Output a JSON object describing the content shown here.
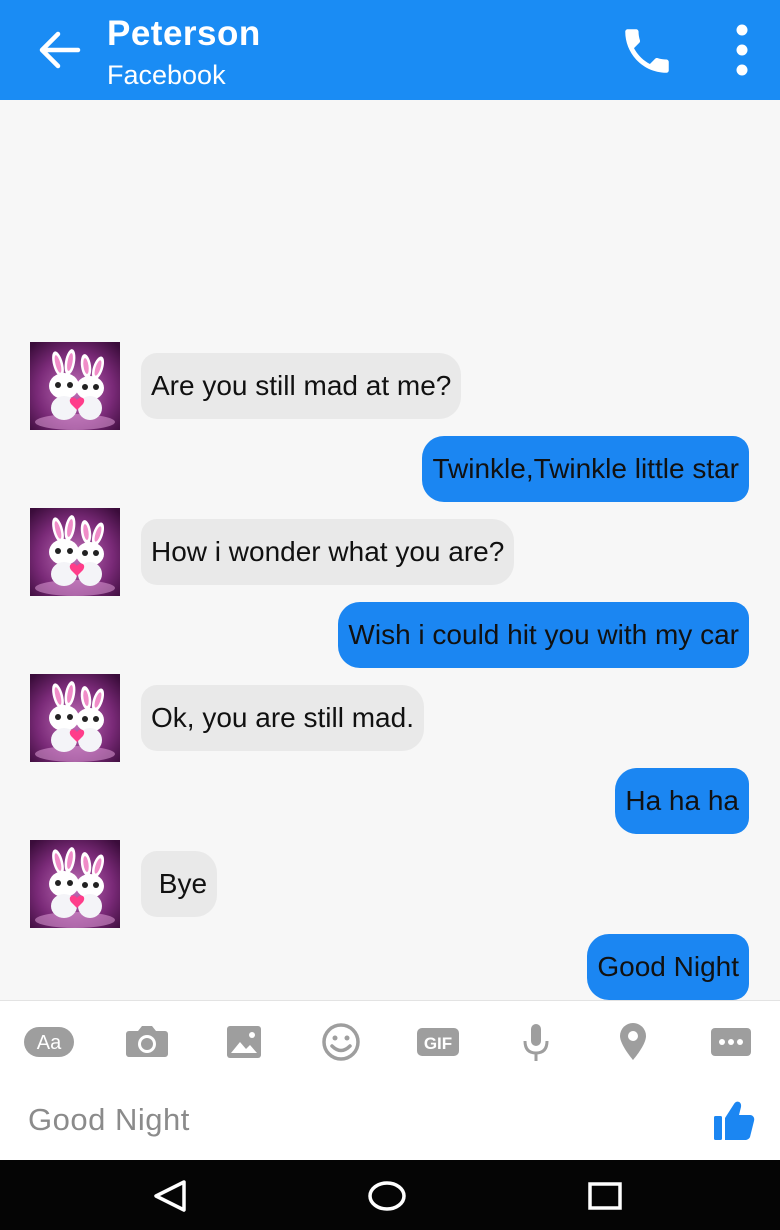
{
  "header": {
    "title": "Peterson",
    "subtitle": "Facebook",
    "back_icon": "arrow-left-icon",
    "call_icon": "phone-icon",
    "more_icon": "more-vert-icon",
    "color": "#1a8cf4"
  },
  "messages": [
    {
      "direction": "in",
      "text": "Are you still mad at me?"
    },
    {
      "direction": "out",
      "text": "Twinkle,Twinkle little star"
    },
    {
      "direction": "in",
      "text": "How i wonder what you are?"
    },
    {
      "direction": "out",
      "text": "Wish i could hit you with my car"
    },
    {
      "direction": "in",
      "text": "Ok, you are still mad."
    },
    {
      "direction": "out",
      "text": "Ha ha ha"
    },
    {
      "direction": "in",
      "text": " Bye"
    },
    {
      "direction": "out",
      "text": "Good Night"
    }
  ],
  "toolbar": {
    "text_label": "Aa",
    "gif_label": "GIF",
    "icons": [
      "text-format-icon",
      "camera-icon",
      "image-icon",
      "emoji-icon",
      "gif-icon",
      "microphone-icon",
      "location-pin-icon",
      "more-icon"
    ]
  },
  "composer": {
    "value": "Good Night",
    "send_icon": "thumbs-up-icon"
  },
  "navbar": {
    "icons": [
      "back-triangle-icon",
      "home-circle-icon",
      "recents-square-icon"
    ]
  },
  "colors": {
    "outgoing_bubble": "#1b86f2",
    "incoming_bubble": "#e9e9e9",
    "background": "#f7f7f7"
  }
}
